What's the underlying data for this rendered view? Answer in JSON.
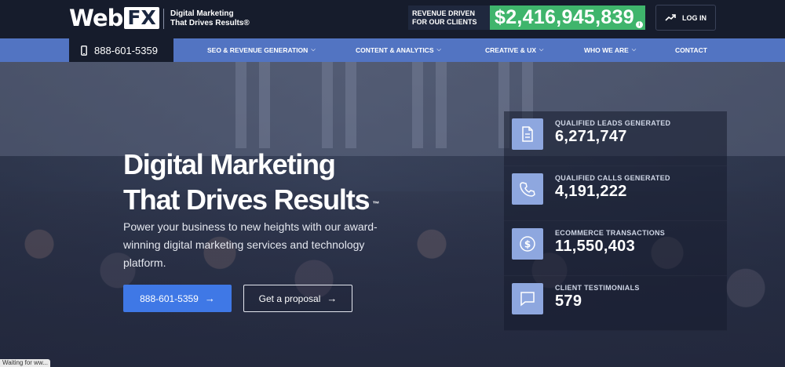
{
  "header": {
    "logo_web": "Web",
    "logo_fx": "FX",
    "tagline_line1": "Digital Marketing",
    "tagline_line2": "That Drives Results®",
    "revenue_label_line1": "REVENUE DRIVEN",
    "revenue_label_line2": "FOR OUR CLIENTS",
    "revenue_value": "$2,416,945,839",
    "revenue_info": "i",
    "login_label": "LOG IN"
  },
  "nav": {
    "phone": "888-601-5359",
    "items": [
      {
        "label": "SEO & REVENUE GENERATION",
        "has_dropdown": true
      },
      {
        "label": "CONTENT & ANALYTICS",
        "has_dropdown": true
      },
      {
        "label": "CREATIVE & UX",
        "has_dropdown": true
      },
      {
        "label": "WHO WE ARE",
        "has_dropdown": true
      },
      {
        "label": "CONTACT",
        "has_dropdown": false
      }
    ]
  },
  "hero": {
    "title_line1": "Digital Marketing",
    "title_line2": "That Drives Results",
    "trademark": "™",
    "subtitle": "Power your business to new heights with our award-winning digital marketing services and technology platform.",
    "cta_phone": "888-601-5359",
    "cta_proposal": "Get a proposal"
  },
  "stats": [
    {
      "icon": "document-icon",
      "label": "QUALIFIED LEADS GENERATED",
      "value": "6,271,747"
    },
    {
      "icon": "phone-icon",
      "label": "QUALIFIED CALLS GENERATED",
      "value": "4,191,222"
    },
    {
      "icon": "dollar-icon",
      "label": "ECOMMERCE TRANSACTIONS",
      "value": "11,550,403"
    },
    {
      "icon": "chat-icon",
      "label": "CLIENT TESTIMONIALS",
      "value": "579"
    }
  ],
  "status_bar": {
    "text": "Waiting for ww..."
  },
  "colors": {
    "header_bg": "#161c2c",
    "nav_bg": "#5274c2",
    "revenue_green": "#3fb56c",
    "cta_blue": "#3f78e6",
    "icon_tile": "#8ea7df"
  }
}
